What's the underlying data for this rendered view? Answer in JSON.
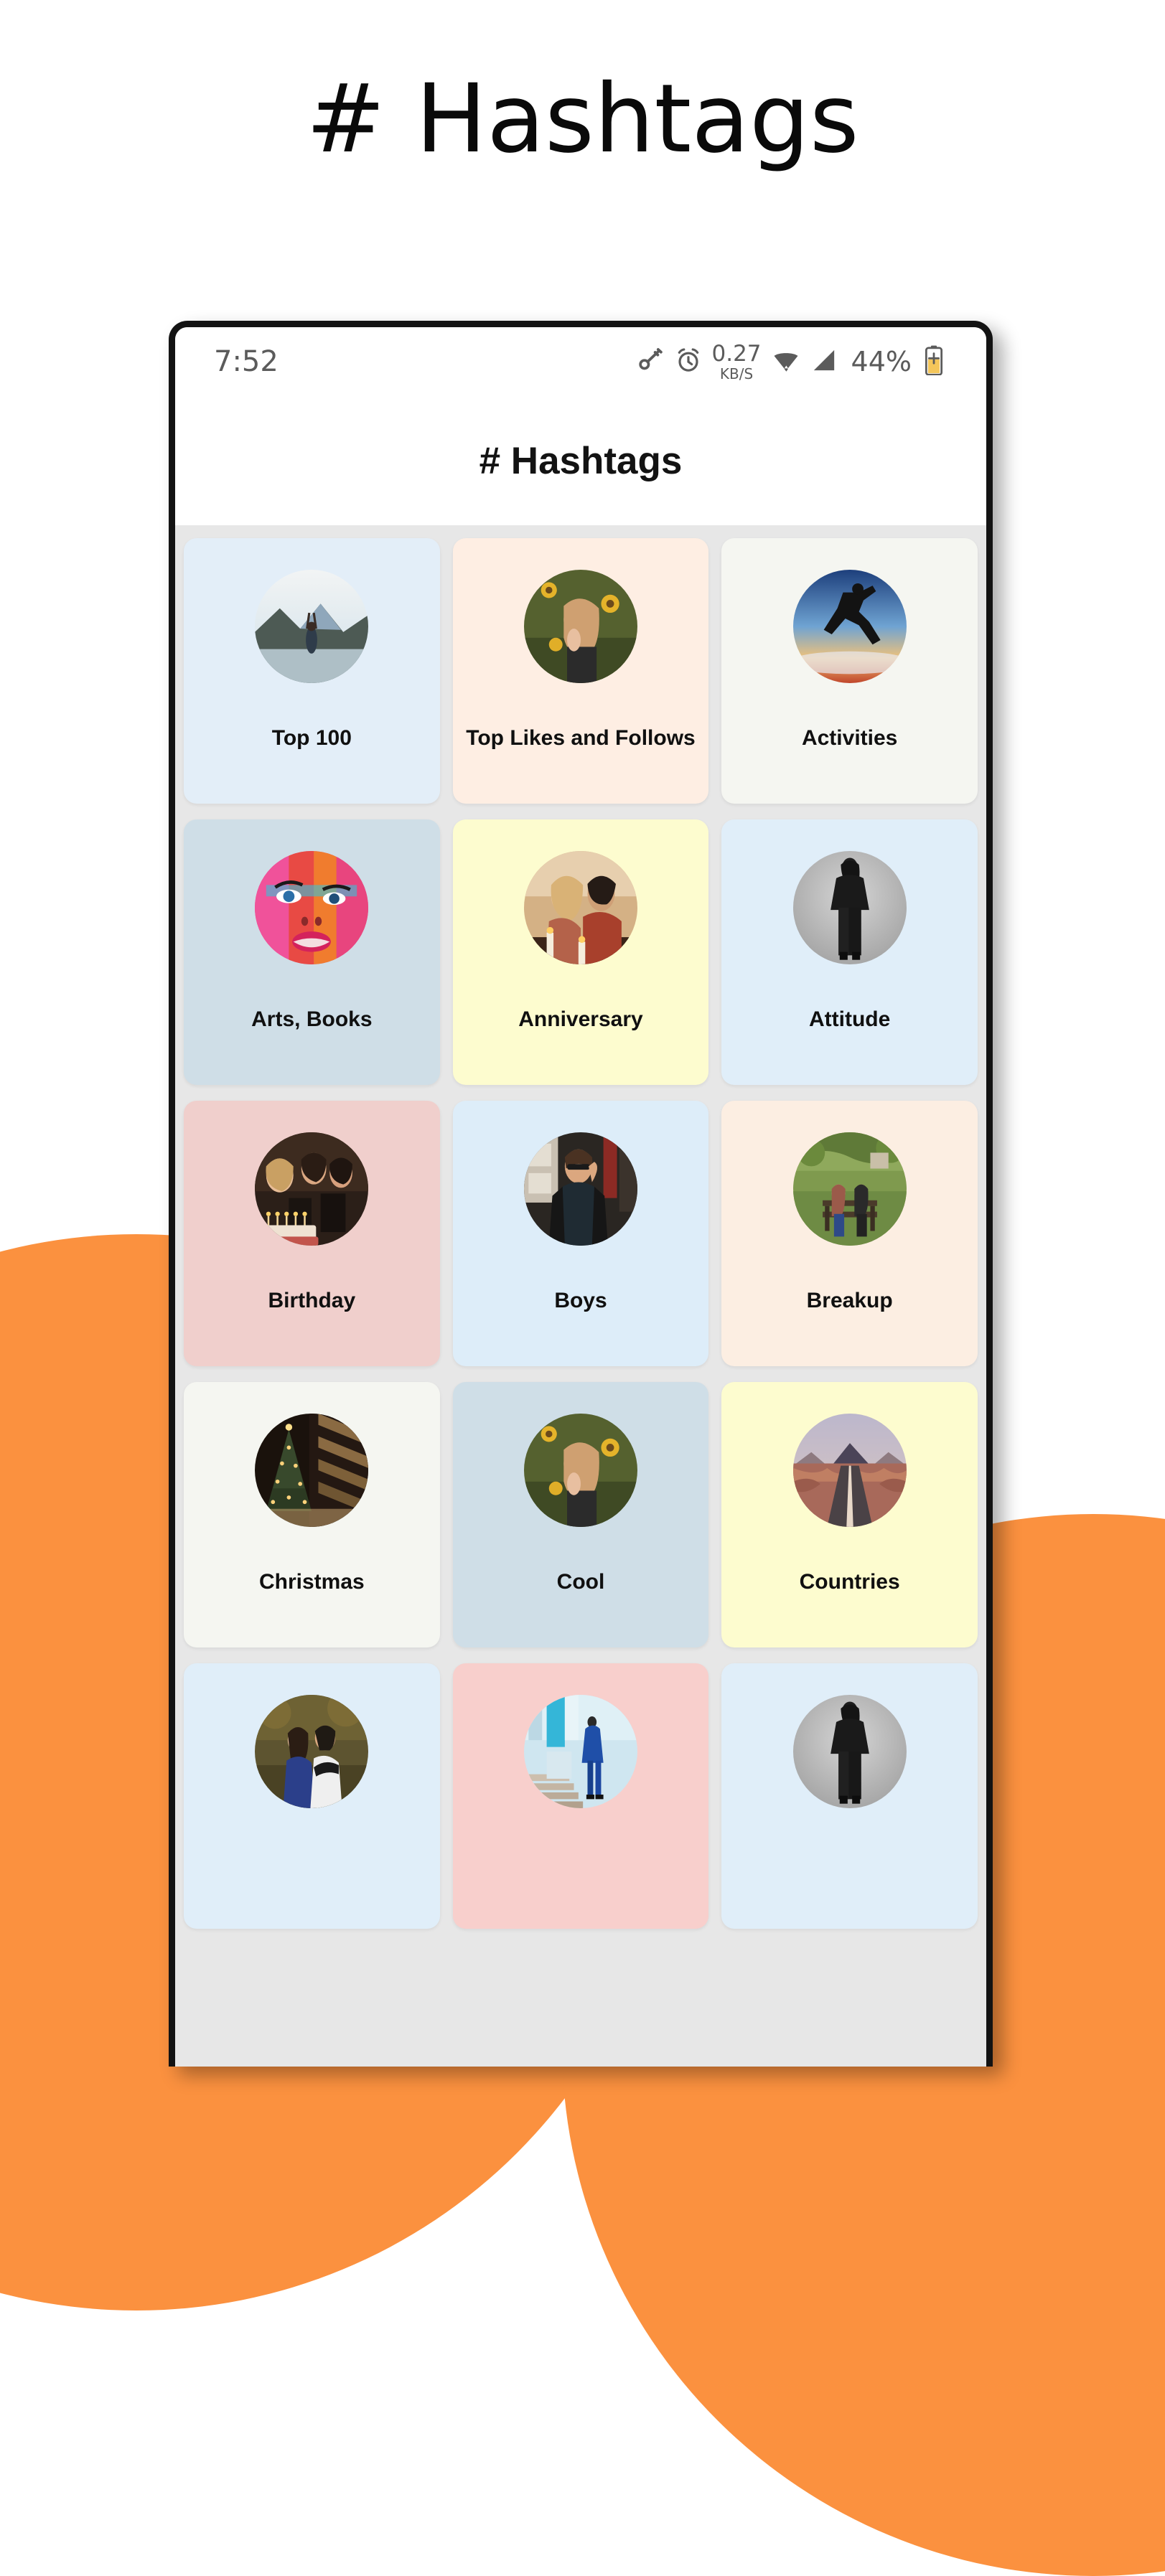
{
  "page": {
    "heading": "# Hashtags",
    "background_color": "#FFFFFF",
    "accent_color": "#FB913F"
  },
  "phone": {
    "status_bar": {
      "time": "7:52",
      "icons": [
        "vpn-key-icon",
        "alarm-clock-icon"
      ],
      "network_speed_value": "0.27",
      "network_speed_unit": "KB/S",
      "wifi_icon": "wifi-icon",
      "signal_icon": "cellular-signal-icon",
      "battery_percent": "44%",
      "battery_icon": "battery-charging-icon"
    },
    "app_bar": {
      "title": "# Hashtags"
    },
    "grid": {
      "background_color": "#E7E7E7",
      "items": [
        {
          "label": "Top 100",
          "color": "#E3EEF8",
          "thumb": "woman-arms-raised-mountain-lake-photo"
        },
        {
          "label": "Top Likes and Follows",
          "color": "#FEEEE3",
          "thumb": "woman-sunflower-field-photo"
        },
        {
          "label": "Activities",
          "color": "#F5F6F1",
          "thumb": "silhouette-jumping-man-sunset-photo"
        },
        {
          "label": "Arts, Books",
          "color": "#CFDEE7",
          "thumb": "colorful-painted-face-art-photo"
        },
        {
          "label": "Anniversary",
          "color": "#FDFCCF",
          "thumb": "couple-candlelight-dinner-photo"
        },
        {
          "label": "Attitude",
          "color": "#E0EEF9",
          "thumb": "woman-black-outfit-gray-background-photo"
        },
        {
          "label": "Birthday",
          "color": "#F0CFCC",
          "thumb": "birthday-cake-candles-party-photo"
        },
        {
          "label": "Boys",
          "color": "#DDEDF9",
          "thumb": "young-man-sunglasses-street-photo"
        },
        {
          "label": "Breakup",
          "color": "#FCEEE2",
          "thumb": "couple-on-park-bench-photo"
        },
        {
          "label": "Christmas",
          "color": "#F5F6F1",
          "thumb": "christmas-tree-lights-interior-photo"
        },
        {
          "label": "Cool",
          "color": "#CFDEE7",
          "thumb": "woman-sunflower-field-photo"
        },
        {
          "label": "Countries",
          "color": "#FDFCCF",
          "thumb": "desert-road-mountain-photo"
        },
        {
          "label": "",
          "color": "#E0EEF9",
          "thumb": "romantic-couple-outdoors-photo"
        },
        {
          "label": "",
          "color": "#F8CFCC",
          "thumb": "man-blue-suit-stairs-photo"
        },
        {
          "label": "",
          "color": "#E0EEF9",
          "thumb": "woman-black-outfit-gray-background-photo"
        }
      ]
    }
  }
}
